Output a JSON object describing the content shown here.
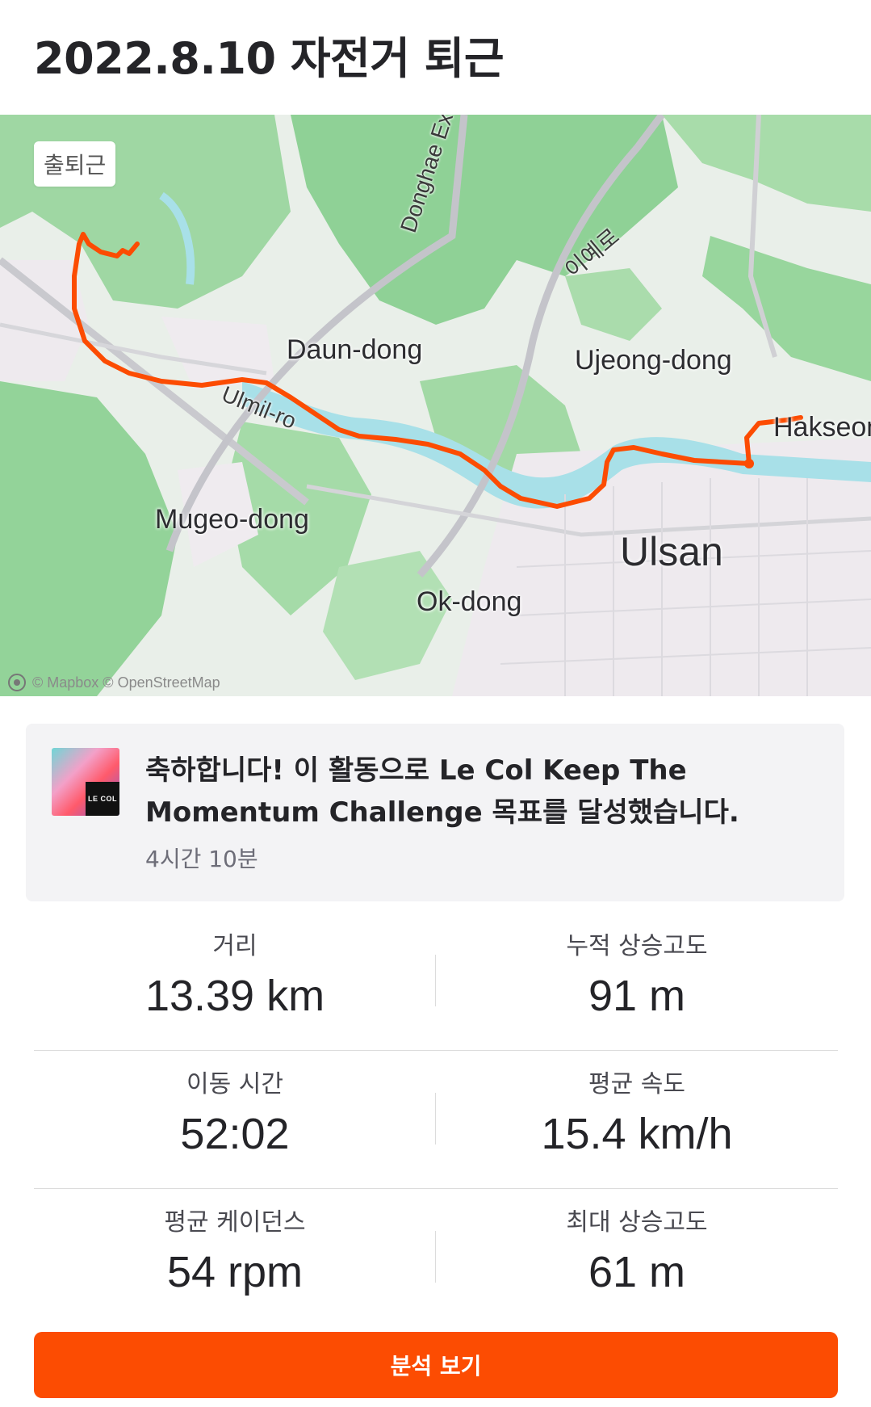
{
  "activity": {
    "title": "2022.8.10 자전거 퇴근"
  },
  "map": {
    "tag": "출퇴근",
    "labels": {
      "daun": "Daun-dong",
      "ujeong": "Ujeong-dong",
      "mugeo": "Mugeo-dong",
      "ulsan": "Ulsan",
      "okdong": "Ok-dong",
      "hakseong": "Hakseon",
      "ulmil": "Ulmil-ro",
      "donghae": "Donghae Ex",
      "iyero": "이예로"
    },
    "attribution": "© Mapbox © OpenStreetMap",
    "colors": {
      "route": "#fc4c02",
      "water": "#a8e0e8",
      "land": "#e8f0ea",
      "park": "#9fdca3"
    }
  },
  "achievement": {
    "icon_badge": "LE COL",
    "text": "축하합니다! 이 활동으로 Le Col Keep The Momentum Challenge 목표를 달성했습니다.",
    "time": "4시간 10분"
  },
  "stats": [
    {
      "left": {
        "label": "거리",
        "value": "13.39 km"
      },
      "right": {
        "label": "누적 상승고도",
        "value": "91 m"
      }
    },
    {
      "left": {
        "label": "이동 시간",
        "value": "52:02"
      },
      "right": {
        "label": "평균 속도",
        "value": "15.4 km/h"
      }
    },
    {
      "left": {
        "label": "평균 케이던스",
        "value": "54 rpm"
      },
      "right": {
        "label": "최대 상승고도",
        "value": "61 m"
      }
    }
  ],
  "actions": {
    "analyze": "분석 보기"
  }
}
